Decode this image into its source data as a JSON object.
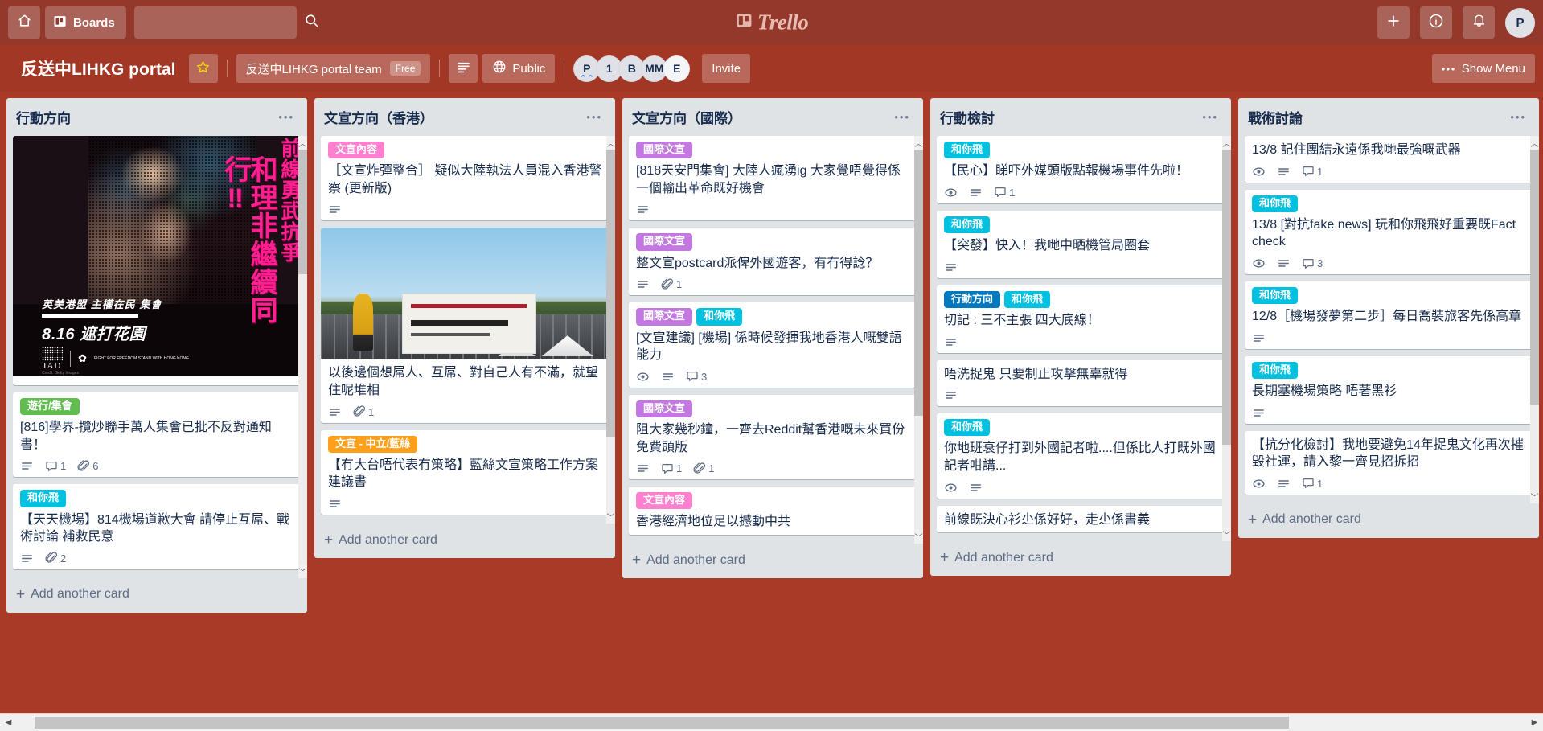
{
  "topnav": {
    "home_icon": "home-icon",
    "boards_label": "Boards",
    "boards_icon": "board-icon",
    "search_placeholder": "",
    "search_value": "",
    "search_icon": "search-icon",
    "logo_text": "Trello",
    "logo_icon": "trello-board-icon",
    "add_icon": "plus-icon",
    "info_icon": "info-icon",
    "notifications_icon": "bell-icon",
    "avatar_initials": "P"
  },
  "boardheader": {
    "title": "反送中LIHKG portal",
    "star_icon": "star-icon",
    "team_name": "反送中LIHKG portal team",
    "team_plan": "Free",
    "view_icon": "list-view-icon",
    "visibility_icon": "globe-icon",
    "visibility": "Public",
    "members": [
      {
        "initials": "P",
        "admin": true
      },
      {
        "initials": "1",
        "admin": false
      },
      {
        "initials": "B",
        "admin": false
      },
      {
        "initials": "MM",
        "admin": false
      },
      {
        "initials": "E",
        "admin": false
      }
    ],
    "invite_label": "Invite",
    "show_menu_label": "Show Menu",
    "show_menu_icon": "ellipsis-icon"
  },
  "labels_colors": {
    "green": "#61BD4F",
    "sky": "#00C2E0",
    "pink": "#FF80CE",
    "orange": "#FF9F1A",
    "purple": "#C377E0",
    "blue": "#0079BF"
  },
  "add_card_label": "Add another card",
  "lists": [
    {
      "title": "行動方向",
      "menu_icon": "list-menu-icon",
      "cards": [
        {
          "cover": "poster",
          "cover_text": {
            "vline1": "前線勇武抗爭",
            "vline2": "和理非繼續同行‼",
            "info1": "英美港盟 主權在民 集會",
            "info2": "8.16 遮打花園",
            "logo": "IAD",
            "logo2": "FIGHT FOR FREEDOM STAND WITH HONG KONG",
            "credit": "Credit: Getty Images"
          },
          "labels": [],
          "title": "",
          "badges": []
        },
        {
          "labels": [
            {
              "text": "遊行/集會",
              "color": "green"
            }
          ],
          "title": "[816]學界-攬炒聯手萬人集會已批不反對通知書！",
          "badges": [
            {
              "icon": "description-icon",
              "value": ""
            },
            {
              "icon": "comment-icon",
              "value": "1"
            },
            {
              "icon": "attachment-icon",
              "value": "6"
            }
          ]
        },
        {
          "labels": [
            {
              "text": "和你飛",
              "color": "sky"
            }
          ],
          "title": "【天天機場】814機場道歉大會 請停止互屌、戰術討論 補救民意",
          "badges": [
            {
              "icon": "description-icon",
              "value": ""
            },
            {
              "icon": "attachment-icon",
              "value": "2"
            }
          ]
        }
      ]
    },
    {
      "title": "文宣方向（香港）",
      "menu_icon": "list-menu-icon",
      "cards": [
        {
          "labels": [
            {
              "text": "文宣內容",
              "color": "pink"
            }
          ],
          "title": "［文宣炸彈整合］ 疑似大陸執法人員混入香港警察 (更新版)",
          "badges": [
            {
              "icon": "description-icon",
              "value": ""
            }
          ]
        },
        {
          "cover": "photo",
          "labels": [],
          "title": "以後邊個想屌人、互屌、對自己人有不滿，就望住呢堆相",
          "badges": [
            {
              "icon": "description-icon",
              "value": ""
            },
            {
              "icon": "attachment-icon",
              "value": "1"
            }
          ]
        },
        {
          "labels": [
            {
              "text": "文宣 - 中立/藍絲",
              "color": "orange"
            }
          ],
          "title": "【冇大台唔代表冇策略】藍絲文宣策略工作方案建議書",
          "badges": [
            {
              "icon": "description-icon",
              "value": ""
            }
          ]
        }
      ]
    },
    {
      "title": "文宣方向（國際）",
      "menu_icon": "list-menu-icon",
      "cards": [
        {
          "labels": [
            {
              "text": "國際文宣",
              "color": "purple"
            }
          ],
          "title": "[818天安門集會] 大陸人瘋湧ig 大家覺唔覺得係一個輸出革命既好機會",
          "badges": [
            {
              "icon": "description-icon",
              "value": ""
            }
          ]
        },
        {
          "labels": [
            {
              "text": "國際文宣",
              "color": "purple"
            }
          ],
          "title": "整文宣postcard派俾外國遊客，有冇得諗？",
          "badges": [
            {
              "icon": "description-icon",
              "value": ""
            },
            {
              "icon": "attachment-icon",
              "value": "1"
            }
          ]
        },
        {
          "labels": [
            {
              "text": "國際文宣",
              "color": "purple"
            },
            {
              "text": "和你飛",
              "color": "sky"
            }
          ],
          "title": "[文宣建議] [機場] 係時候發揮我地香港人嘅雙語能力",
          "badges": [
            {
              "icon": "watch-icon",
              "value": ""
            },
            {
              "icon": "description-icon",
              "value": ""
            },
            {
              "icon": "comment-icon",
              "value": "3"
            }
          ]
        },
        {
          "labels": [
            {
              "text": "國際文宣",
              "color": "purple"
            }
          ],
          "title": "阻大家幾秒鐘，一齊去Reddit幫香港嘅未來買份免費頭版",
          "badges": [
            {
              "icon": "description-icon",
              "value": ""
            },
            {
              "icon": "comment-icon",
              "value": "1"
            },
            {
              "icon": "attachment-icon",
              "value": "1"
            }
          ]
        },
        {
          "labels": [
            {
              "text": "文宣內容",
              "color": "pink"
            }
          ],
          "title": "香港經濟地位足以撼動中共",
          "badges": []
        }
      ]
    },
    {
      "title": "行動檢討",
      "menu_icon": "list-menu-icon",
      "cards": [
        {
          "labels": [
            {
              "text": "和你飛",
              "color": "sky"
            }
          ],
          "title": "【民心】睇吓外媒頭版點報機場事件先啦！",
          "badges": [
            {
              "icon": "watch-icon",
              "value": ""
            },
            {
              "icon": "description-icon",
              "value": ""
            },
            {
              "icon": "comment-icon",
              "value": "1"
            }
          ]
        },
        {
          "labels": [
            {
              "text": "和你飛",
              "color": "sky"
            }
          ],
          "title": "【突發】快入！我哋中晒機管局圈套",
          "badges": [
            {
              "icon": "description-icon",
              "value": ""
            }
          ]
        },
        {
          "labels": [
            {
              "text": "行動方向",
              "color": "blue"
            },
            {
              "text": "和你飛",
              "color": "sky"
            }
          ],
          "title": "切記 : 三不主張 四大底線！",
          "badges": [
            {
              "icon": "description-icon",
              "value": ""
            }
          ]
        },
        {
          "labels": [],
          "title": "唔洗捉鬼 只要制止攻擊無辜就得",
          "badges": [
            {
              "icon": "description-icon",
              "value": ""
            }
          ]
        },
        {
          "labels": [
            {
              "text": "和你飛",
              "color": "sky"
            }
          ],
          "title": "你地班衰仔打到外國記者啦....但係比人打既外國記者咁講...",
          "badges": [
            {
              "icon": "watch-icon",
              "value": ""
            },
            {
              "icon": "description-icon",
              "value": ""
            }
          ]
        },
        {
          "labels": [],
          "title": "前線既決心衫尐係好好，走尐係書義",
          "badges": []
        }
      ]
    },
    {
      "title": "戰術討論",
      "menu_icon": "list-menu-icon",
      "cards": [
        {
          "labels": [],
          "title": "13/8 記住團結永遠係我哋最強嘅武器",
          "badges": [
            {
              "icon": "watch-icon",
              "value": ""
            },
            {
              "icon": "description-icon",
              "value": ""
            },
            {
              "icon": "comment-icon",
              "value": "1"
            }
          ]
        },
        {
          "labels": [
            {
              "text": "和你飛",
              "color": "sky"
            }
          ],
          "title": "13/8 [對抗fake news] 玩和你飛飛好重要既Fact check",
          "badges": [
            {
              "icon": "watch-icon",
              "value": ""
            },
            {
              "icon": "description-icon",
              "value": ""
            },
            {
              "icon": "comment-icon",
              "value": "3"
            }
          ]
        },
        {
          "labels": [
            {
              "text": "和你飛",
              "color": "sky"
            }
          ],
          "title": "12/8［機場發夢第二步］每日喬裝旅客先係高章",
          "badges": [
            {
              "icon": "description-icon",
              "value": ""
            }
          ]
        },
        {
          "labels": [
            {
              "text": "和你飛",
              "color": "sky"
            }
          ],
          "title": "長期塞機場策略 唔著黑衫",
          "badges": [
            {
              "icon": "description-icon",
              "value": ""
            }
          ]
        },
        {
          "labels": [],
          "title": "【抗分化檢討】我地要避免14年捉鬼文化再次摧毀社運，請入黎一齊見招拆招",
          "badges": [
            {
              "icon": "watch-icon",
              "value": ""
            },
            {
              "icon": "description-icon",
              "value": ""
            },
            {
              "icon": "comment-icon",
              "value": "1"
            }
          ]
        }
      ]
    }
  ]
}
